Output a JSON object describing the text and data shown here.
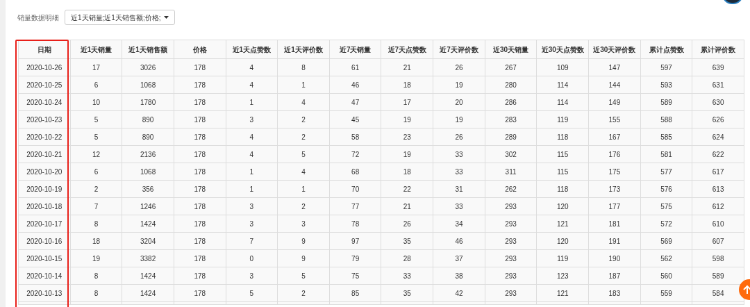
{
  "filter": {
    "label": "销量数据明细",
    "dropdown": "近1天销量;近1天销售额;价格;"
  },
  "table": {
    "columns": [
      {
        "label": "日期",
        "highlighted": true
      },
      {
        "label": "近1天销量",
        "highlighted": false
      },
      {
        "label": "近1天销售额",
        "highlighted": false
      },
      {
        "label": "价格",
        "highlighted": false
      },
      {
        "label": "近1天点赞数",
        "highlighted": false
      },
      {
        "label": "近1天评价数",
        "highlighted": false
      },
      {
        "label": "近7天销量",
        "highlighted": false
      },
      {
        "label": "近7天点赞数",
        "highlighted": false
      },
      {
        "label": "近7天评价数",
        "highlighted": false
      },
      {
        "label": "近30天销量",
        "highlighted": false
      },
      {
        "label": "近30天点赞数",
        "highlighted": false
      },
      {
        "label": "近30天评价数",
        "highlighted": false
      },
      {
        "label": "累计点赞数",
        "highlighted": false
      },
      {
        "label": "累计评价数",
        "highlighted": false
      }
    ],
    "rows": [
      [
        "2020-10-26",
        "17",
        "3026",
        "178",
        "4",
        "8",
        "61",
        "21",
        "26",
        "267",
        "109",
        "147",
        "597",
        "639"
      ],
      [
        "2020-10-25",
        "6",
        "1068",
        "178",
        "4",
        "1",
        "46",
        "18",
        "19",
        "280",
        "114",
        "144",
        "593",
        "631"
      ],
      [
        "2020-10-24",
        "10",
        "1780",
        "178",
        "1",
        "4",
        "47",
        "17",
        "20",
        "286",
        "114",
        "149",
        "589",
        "630"
      ],
      [
        "2020-10-23",
        "5",
        "890",
        "178",
        "3",
        "2",
        "45",
        "19",
        "19",
        "283",
        "119",
        "155",
        "588",
        "626"
      ],
      [
        "2020-10-22",
        "5",
        "890",
        "178",
        "4",
        "2",
        "58",
        "23",
        "26",
        "289",
        "118",
        "167",
        "585",
        "624"
      ],
      [
        "2020-10-21",
        "12",
        "2136",
        "178",
        "4",
        "5",
        "72",
        "19",
        "33",
        "302",
        "115",
        "176",
        "581",
        "622"
      ],
      [
        "2020-10-20",
        "6",
        "1068",
        "178",
        "1",
        "4",
        "68",
        "18",
        "33",
        "311",
        "115",
        "175",
        "577",
        "617"
      ],
      [
        "2020-10-19",
        "2",
        "356",
        "178",
        "1",
        "1",
        "70",
        "22",
        "31",
        "262",
        "118",
        "173",
        "576",
        "613"
      ],
      [
        "2020-10-18",
        "7",
        "1246",
        "178",
        "3",
        "2",
        "77",
        "21",
        "33",
        "293",
        "120",
        "177",
        "575",
        "612"
      ],
      [
        "2020-10-17",
        "8",
        "1424",
        "178",
        "3",
        "3",
        "78",
        "26",
        "34",
        "293",
        "121",
        "181",
        "572",
        "610"
      ],
      [
        "2020-10-16",
        "18",
        "3204",
        "178",
        "7",
        "9",
        "97",
        "35",
        "46",
        "293",
        "120",
        "191",
        "569",
        "607"
      ],
      [
        "2020-10-15",
        "19",
        "3382",
        "178",
        "0",
        "9",
        "79",
        "28",
        "37",
        "293",
        "119",
        "190",
        "562",
        "598"
      ],
      [
        "2020-10-14",
        "8",
        "1424",
        "178",
        "3",
        "5",
        "75",
        "33",
        "38",
        "293",
        "123",
        "187",
        "560",
        "589"
      ],
      [
        "2020-10-13",
        "8",
        "1424",
        "178",
        "5",
        "2",
        "85",
        "35",
        "42",
        "293",
        "121",
        "183",
        "559",
        "584"
      ]
    ]
  }
}
